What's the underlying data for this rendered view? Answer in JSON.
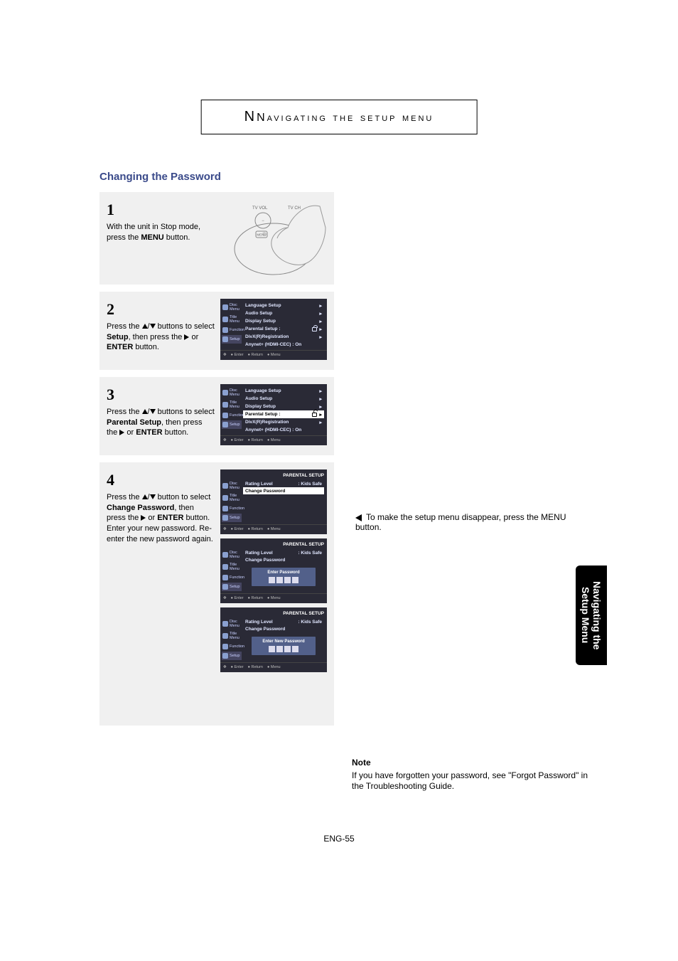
{
  "header": "Navigating the setup menu",
  "section_title": "Changing the Password",
  "steps": {
    "s1": {
      "num": "1",
      "text_a": "With the unit in Stop mode, press the ",
      "text_b": "MENU",
      "text_c": " button."
    },
    "s2": {
      "num": "2",
      "text_a": "Press the ",
      "text_b": " buttons to select ",
      "text_c": "Setup",
      "text_d": ", then press the ",
      "text_e": " or ",
      "text_f": "ENTER",
      "text_g": " button."
    },
    "s3": {
      "num": "3",
      "text_a": "Press the ",
      "text_b": " buttons to select ",
      "text_c": "Parental Setup",
      "text_d": ", then press the ",
      "text_e": " or ",
      "text_f": "ENTER",
      "text_g": " button."
    },
    "s4": {
      "num": "4",
      "text_a": "Press the ",
      "text_b": " button to select ",
      "text_c": "Change Password",
      "text_d": ", then press the ",
      "text_e": " or ",
      "text_f": "ENTER",
      "text_g": " button. Enter your new password. Re-enter the new password again."
    }
  },
  "remote": {
    "tv_vol": "TV VOL",
    "tv_ch": "TV CH",
    "menu": "MENU"
  },
  "osd": {
    "side": {
      "disc": "Disc Menu",
      "title": "Title Menu",
      "function": "Function",
      "setup": "Setup"
    },
    "main_setup": {
      "i1": "Language Setup",
      "i2": "Audio Setup",
      "i3": "Display Setup",
      "i4": "Parental Setup :",
      "i5": "DivX(R)Registration",
      "i6": "Anynet+ (HDMI-CEC) : On"
    },
    "parental": {
      "title": "PARENTAL SETUP",
      "rating": "Rating Level",
      "rating_val": ": Kids Safe",
      "change": "Change Password",
      "enter_pw": "Enter Password",
      "enter_new_pw": "Enter New Password"
    },
    "footer": {
      "enter": "Enter",
      "return": "Return",
      "menu": "Menu"
    }
  },
  "right_note": "To make the setup menu disappear, press the MENU button.",
  "side_tab_l1": "Navigating the",
  "side_tab_l2": "Setup Menu",
  "bottom_note": {
    "heading": "Note",
    "body": "If you have forgotten your password, see \"Forgot Password\" in the Troubleshooting Guide."
  },
  "page_num": "ENG-55"
}
